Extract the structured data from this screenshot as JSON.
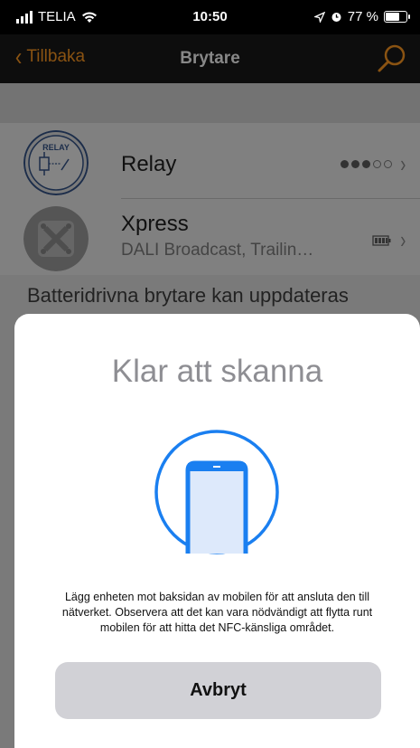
{
  "status_bar": {
    "carrier": "TELIA",
    "time": "10:50",
    "battery_percent": "77 %",
    "battery_level": 0.77
  },
  "nav": {
    "back_label": "Tillbaka",
    "title": "Brytare",
    "accent_color": "#8a5312"
  },
  "list": {
    "items": [
      {
        "title": "Relay",
        "subtitle": "",
        "icon": "relay-logo-icon",
        "signal_strength": 3,
        "signal_max": 5
      },
      {
        "title": "Xpress",
        "subtitle": "DALI Broadcast, Trailin…",
        "icon": "xpress-device-icon",
        "battery_icon": "battery-icon"
      }
    ],
    "footer": "Batteridrivna brytare kan uppdateras"
  },
  "sheet": {
    "title": "Klar att skanna",
    "message": "Lägg enheten mot baksidan av mobilen för att ansluta den till nätverket. Observera att det kan vara nödvändigt att flytta runt mobilen för att hitta det NFC-känsliga området.",
    "cancel_label": "Avbryt",
    "graphic_icon": "phone-scan-icon",
    "graphic_color": "#1a7ff0"
  },
  "relay_logo_text": "RELAY"
}
